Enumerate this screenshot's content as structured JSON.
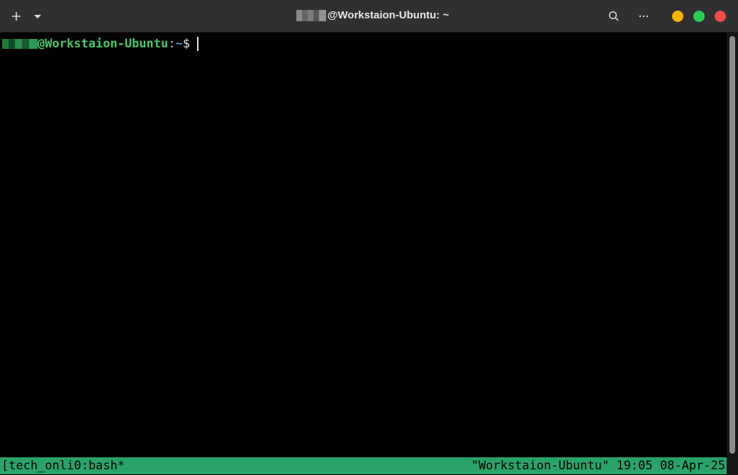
{
  "window": {
    "title_suffix": "@Workstaion-Ubuntu: ~"
  },
  "header": {
    "icons": {
      "new_tab": "plus-icon",
      "tab_menu": "chevron-down-icon",
      "search": "search-icon",
      "menu": "more-horizontal-icon"
    },
    "window_controls": {
      "minimize_color": "#f4b400",
      "maximize_color": "#2ecc55",
      "close_color": "#f24c4c"
    }
  },
  "terminal": {
    "prompt": {
      "host": "@Workstaion-Ubuntu",
      "colon": ":",
      "path": "~",
      "symbol": "$"
    },
    "colors": {
      "host": "#4ac96b",
      "path": "#5a8fe0",
      "background": "#000000"
    }
  },
  "statusbar": {
    "left": "[tech_onli0:bash*",
    "right": "\"Workstaion-Ubuntu\" 19:05 08-Apr-25",
    "background": "#2aa368"
  }
}
